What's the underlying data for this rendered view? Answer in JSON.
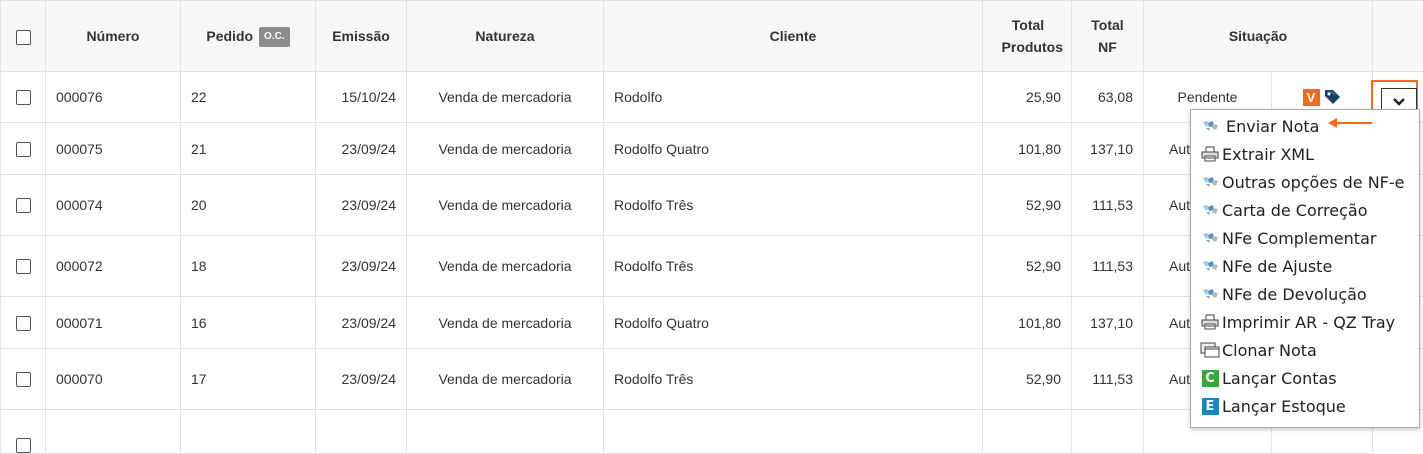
{
  "table": {
    "headers": {
      "numero": "Número",
      "pedido": "Pedido",
      "oc_badge": "O.C.",
      "emissao": "Emissão",
      "natureza": "Natureza",
      "cliente": "Cliente",
      "total_produtos_1": "Total",
      "total_produtos_2": "Produtos",
      "total_nf_1": "Total",
      "total_nf_2": "NF",
      "situacao": "Situação"
    },
    "rows": [
      {
        "numero": "000076",
        "pedido": "22",
        "emissao": "15/10/24",
        "natureza": "Venda de mercadoria",
        "cliente": "Rodolfo",
        "total_produtos": "25,90",
        "total_nf": "63,08",
        "situacao": "Pendente"
      },
      {
        "numero": "000075",
        "pedido": "21",
        "emissao": "23/09/24",
        "natureza": "Venda de mercadoria",
        "cliente": "Rodolfo Quatro",
        "total_produtos": "101,80",
        "total_nf": "137,10",
        "situacao": "Aut"
      },
      {
        "numero": "000074",
        "pedido": "20",
        "emissao": "23/09/24",
        "natureza": "Venda de mercadoria",
        "cliente": "Rodolfo Três",
        "total_produtos": "52,90",
        "total_nf": "111,53",
        "situacao": "Aut"
      },
      {
        "numero": "000072",
        "pedido": "18",
        "emissao": "23/09/24",
        "natureza": "Venda de mercadoria",
        "cliente": "Rodolfo Três",
        "total_produtos": "52,90",
        "total_nf": "111,53",
        "situacao": "Aut"
      },
      {
        "numero": "000071",
        "pedido": "16",
        "emissao": "23/09/24",
        "natureza": "Venda de mercadoria",
        "cliente": "Rodolfo Quatro",
        "total_produtos": "101,80",
        "total_nf": "137,10",
        "situacao": "Aut"
      },
      {
        "numero": "000070",
        "pedido": "17",
        "emissao": "23/09/24",
        "natureza": "Venda de mercadoria",
        "cliente": "Rodolfo Três",
        "total_produtos": "52,90",
        "total_nf": "111,53",
        "situacao": "Aut"
      }
    ],
    "row0_badge": "V"
  },
  "dropdown_menu": {
    "items": [
      {
        "label": "Enviar Nota",
        "icon": "nfe-icon"
      },
      {
        "label": "Extrair XML",
        "icon": "printer-icon"
      },
      {
        "label": "Outras opções de NF-e",
        "icon": "nfe-icon"
      },
      {
        "label": "Carta de Correção",
        "icon": "nfe-icon"
      },
      {
        "label": "NFe Complementar",
        "icon": "nfe-icon"
      },
      {
        "label": "NFe de Ajuste",
        "icon": "nfe-icon"
      },
      {
        "label": "NFe de Devolução",
        "icon": "nfe-icon"
      },
      {
        "label": "Imprimir AR - QZ Tray",
        "icon": "printer-icon"
      },
      {
        "label": "Clonar Nota",
        "icon": "clone-icon"
      },
      {
        "label": "Lançar Contas",
        "icon": "c-square-icon",
        "icon_letter": "C"
      },
      {
        "label": "Lançar Estoque",
        "icon": "e-square-icon",
        "icon_letter": "E"
      }
    ]
  },
  "colors": {
    "accent": "#f26a1b",
    "contas_green": "#3aa53a",
    "estoque_blue": "#1e84b9",
    "header_bg": "#f7f7f7"
  }
}
